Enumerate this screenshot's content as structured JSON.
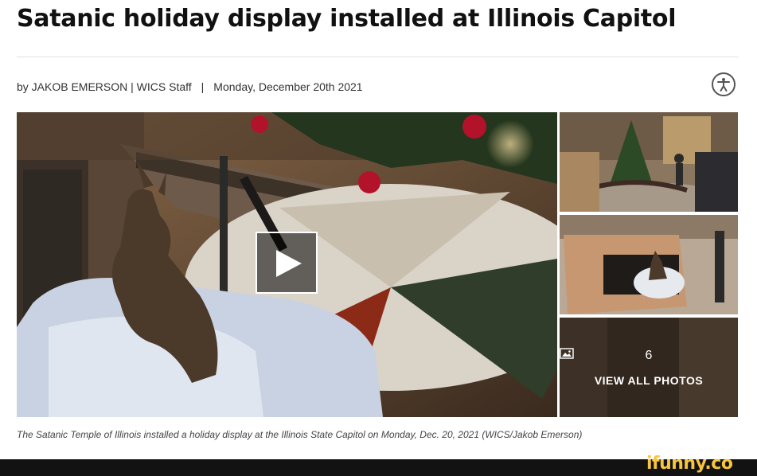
{
  "article": {
    "headline": "Satanic holiday display installed at Illinois Capitol",
    "byline": {
      "author": "by JAKOB EMERSON | WICS Staff",
      "separator": "|",
      "date": "Monday, December 20th 2021"
    },
    "caption": "The Satanic Temple of Illinois installed a holiday display at the Illinois State Capitol on Monday, Dec. 20, 2021 (WICS/Jakob Emerson)"
  },
  "gallery": {
    "photo_count": "6",
    "view_all_label": "VIEW ALL PHOTOS"
  },
  "watermark": "ifunny.co",
  "icons": {
    "accessibility": "accessibility-icon",
    "play": "play-icon",
    "photos": "image-icon"
  }
}
